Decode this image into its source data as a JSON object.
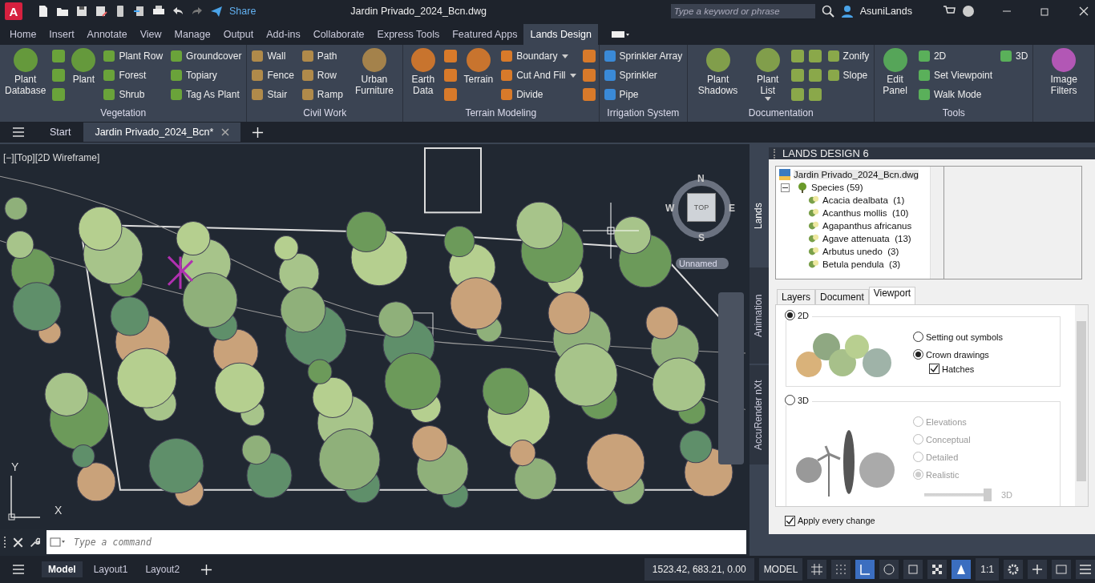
{
  "title_bar": {
    "app_logo": "A",
    "share": "Share",
    "document": "Jardin Privado_2024_Bcn.dwg",
    "search": {
      "placeholder": "Type a keyword or phrase"
    },
    "user": "AsuniLands"
  },
  "ribbon_tabs": [
    {
      "label": "Home",
      "selected": false
    },
    {
      "label": "Insert",
      "selected": false
    },
    {
      "label": "Annotate",
      "selected": false
    },
    {
      "label": "View",
      "selected": false
    },
    {
      "label": "Manage",
      "selected": false
    },
    {
      "label": "Output",
      "selected": false
    },
    {
      "label": "Add-ins",
      "selected": false
    },
    {
      "label": "Collaborate",
      "selected": false
    },
    {
      "label": "Express Tools",
      "selected": false
    },
    {
      "label": "Featured Apps",
      "selected": false
    },
    {
      "label": "Lands Design",
      "selected": true
    }
  ],
  "ribbon_panels": [
    {
      "title": "Vegetation",
      "columns": [
        [
          {
            "kind": "large",
            "label": "Plant Database"
          }
        ],
        [
          {
            "kind": "icon"
          },
          {
            "kind": "icon"
          },
          {
            "kind": "icon"
          }
        ],
        [
          {
            "kind": "large",
            "label": "Plant"
          }
        ],
        [
          {
            "kind": "small",
            "label": "Plant Row"
          },
          {
            "kind": "small",
            "label": "Forest"
          },
          {
            "kind": "small",
            "label": "Shrub"
          }
        ],
        [
          {
            "kind": "small",
            "label": "Groundcover"
          },
          {
            "kind": "small",
            "label": "Topiary"
          },
          {
            "kind": "small",
            "label": "Tag As Plant"
          }
        ]
      ]
    },
    {
      "title": "Civil Work",
      "columns": [
        [
          {
            "kind": "small",
            "label": "Wall"
          },
          {
            "kind": "small",
            "label": "Fence"
          },
          {
            "kind": "small",
            "label": "Stair"
          }
        ],
        [
          {
            "kind": "small",
            "label": "Path"
          },
          {
            "kind": "small",
            "label": "Row"
          },
          {
            "kind": "small",
            "label": "Ramp"
          }
        ],
        [
          {
            "kind": "large",
            "label": "Urban Furniture"
          }
        ]
      ]
    },
    {
      "title": "Terrain Modeling",
      "columns": [
        [
          {
            "kind": "large",
            "label": "Earth Data"
          }
        ],
        [
          {
            "kind": "icon"
          },
          {
            "kind": "icon"
          },
          {
            "kind": "icon"
          }
        ],
        [
          {
            "kind": "large",
            "label": "Terrain"
          }
        ],
        [
          {
            "kind": "small",
            "label": "Boundary",
            "dropdown": true
          },
          {
            "kind": "small",
            "label": "Cut And Fill",
            "dropdown": true
          },
          {
            "kind": "small",
            "label": "Divide"
          }
        ],
        [
          {
            "kind": "icon"
          },
          {
            "kind": "icon"
          },
          {
            "kind": "icon"
          }
        ]
      ]
    },
    {
      "title": "Irrigation System",
      "columns": [
        [
          {
            "kind": "small",
            "label": "Sprinkler Array"
          },
          {
            "kind": "small",
            "label": "Sprinkler"
          },
          {
            "kind": "small",
            "label": "Pipe"
          }
        ]
      ]
    },
    {
      "title": "Documentation",
      "columns": [
        [
          {
            "kind": "large",
            "label": "Plant Shadows"
          }
        ],
        [
          {
            "kind": "large",
            "label": "Plant List",
            "dropdown": true
          }
        ],
        [
          {
            "kind": "icon"
          },
          {
            "kind": "icon"
          },
          {
            "kind": "icon"
          }
        ],
        [
          {
            "kind": "icon"
          },
          {
            "kind": "icon"
          },
          {
            "kind": "icon"
          }
        ],
        [
          {
            "kind": "small",
            "label": "Zonify"
          },
          {
            "kind": "small",
            "label": "Slope"
          }
        ]
      ]
    },
    {
      "title": "Tools",
      "columns": [
        [
          {
            "kind": "large",
            "label": "Edit Panel"
          }
        ],
        [
          {
            "kind": "small",
            "label": "2D"
          },
          {
            "kind": "small",
            "label": "Set Viewpoint"
          },
          {
            "kind": "small",
            "label": "Walk Mode"
          }
        ],
        [
          {
            "kind": "small",
            "label": "3D"
          }
        ]
      ]
    },
    {
      "columns": [
        [
          {
            "kind": "large",
            "label": "Image Filters"
          }
        ]
      ]
    }
  ],
  "document_tabs": [
    {
      "label": "Start",
      "selected": false,
      "closable": false
    },
    {
      "label": "Jardin Privado_2024_Bcn*",
      "selected": true,
      "closable": true
    }
  ],
  "viewport": {
    "label": "[−][Top][2D Wireframe]",
    "viewcube": {
      "north": "N",
      "south": "S",
      "east": "E",
      "west": "W",
      "face": "TOP",
      "view_name": "Unnamed"
    },
    "ucs": {
      "x_label": "X",
      "y_label": "Y"
    }
  },
  "command_line": {
    "placeholder": "Type a command"
  },
  "palette": {
    "title": "LANDS DESIGN 6",
    "side_tabs": [
      {
        "label": "Lands",
        "selected": true
      },
      {
        "label": "Animation",
        "selected": false
      },
      {
        "label": "AccuRender nXt",
        "selected": false
      }
    ],
    "tree": {
      "label": "Jardin Privado_2024_Bcn.dwg",
      "children": [
        {
          "label": "Species (59)",
          "expanded": true,
          "children": [
            {
              "label": "Acacia dealbata",
              "count": "(1)"
            },
            {
              "label": "Acanthus mollis",
              "count": "(10)"
            },
            {
              "label": "Agapanthus africanus"
            },
            {
              "label": "Agave attenuata",
              "count": "(13)"
            },
            {
              "label": "Arbutus unedo",
              "count": "(3)"
            },
            {
              "label": "Betula pendula",
              "count": "(3)"
            }
          ]
        }
      ]
    },
    "tabs": [
      {
        "label": "Layers",
        "selected": false
      },
      {
        "label": "Document",
        "selected": false
      },
      {
        "label": "Viewport",
        "selected": true
      }
    ],
    "mode_2d": {
      "label": "2D",
      "selected": true,
      "options": [
        {
          "label": "Setting out symbols",
          "selected": false
        },
        {
          "label": "Crown drawings",
          "selected": true
        }
      ],
      "hatches": {
        "label": "Hatches",
        "checked": true
      }
    },
    "mode_3d": {
      "label": "3D",
      "selected": false,
      "options": [
        {
          "label": "Elevations",
          "selected": false,
          "disabled": true
        },
        {
          "label": "Conceptual",
          "selected": false,
          "disabled": true
        },
        {
          "label": "Detailed",
          "selected": false,
          "disabled": true
        },
        {
          "label": "Realistic",
          "selected": true,
          "disabled": true
        }
      ],
      "slider": {
        "level": 1,
        "label": "3D"
      }
    },
    "apply_every_change": {
      "label": "Apply every change",
      "checked": true
    }
  },
  "status_bar": {
    "layout_tabs": [
      {
        "label": "Model",
        "selected": true
      },
      {
        "label": "Layout1",
        "selected": false
      },
      {
        "label": "Layout2",
        "selected": false
      }
    ],
    "coordinates": "1523.42, 683.21, 0.00",
    "space": "MODEL",
    "scale": "1:1"
  }
}
